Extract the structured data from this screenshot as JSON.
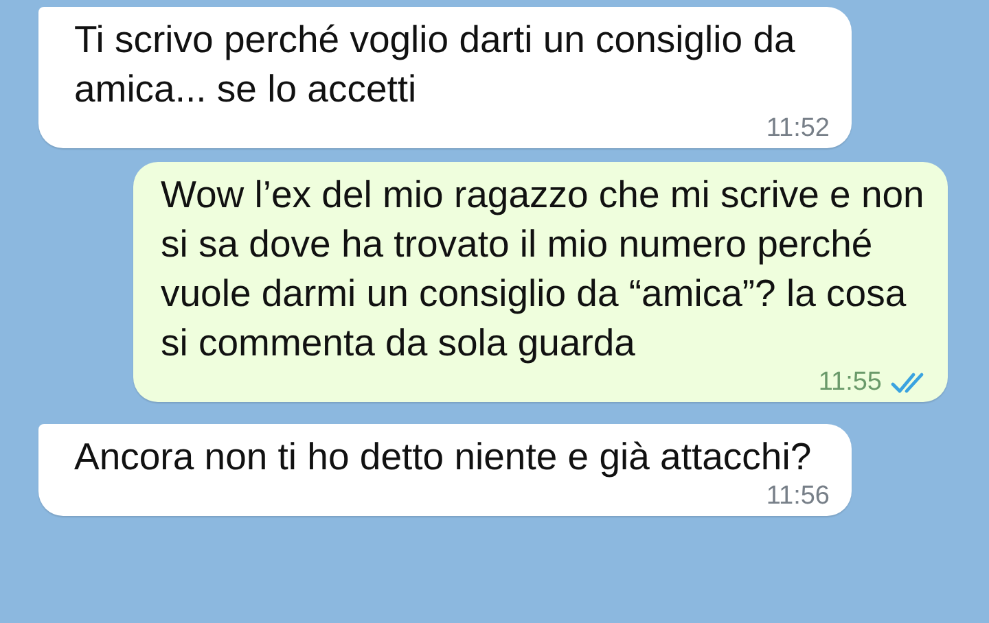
{
  "messages": [
    {
      "kind": "incoming",
      "text": "Ti scrivo perché voglio darti un consiglio da amica... se lo accetti",
      "time": "11:52"
    },
    {
      "kind": "outgoing",
      "text": "Wow l’ex del mio ragazzo che mi scrive e non si sa dove ha trovato il mio numero perché vuole darmi un consiglio da “amica”? la cosa si commenta da sola guarda",
      "time": "11:55",
      "read": true
    },
    {
      "kind": "incoming",
      "text": "Ancora non ti ho detto niente e già attacchi?",
      "time": "11:56"
    }
  ]
}
